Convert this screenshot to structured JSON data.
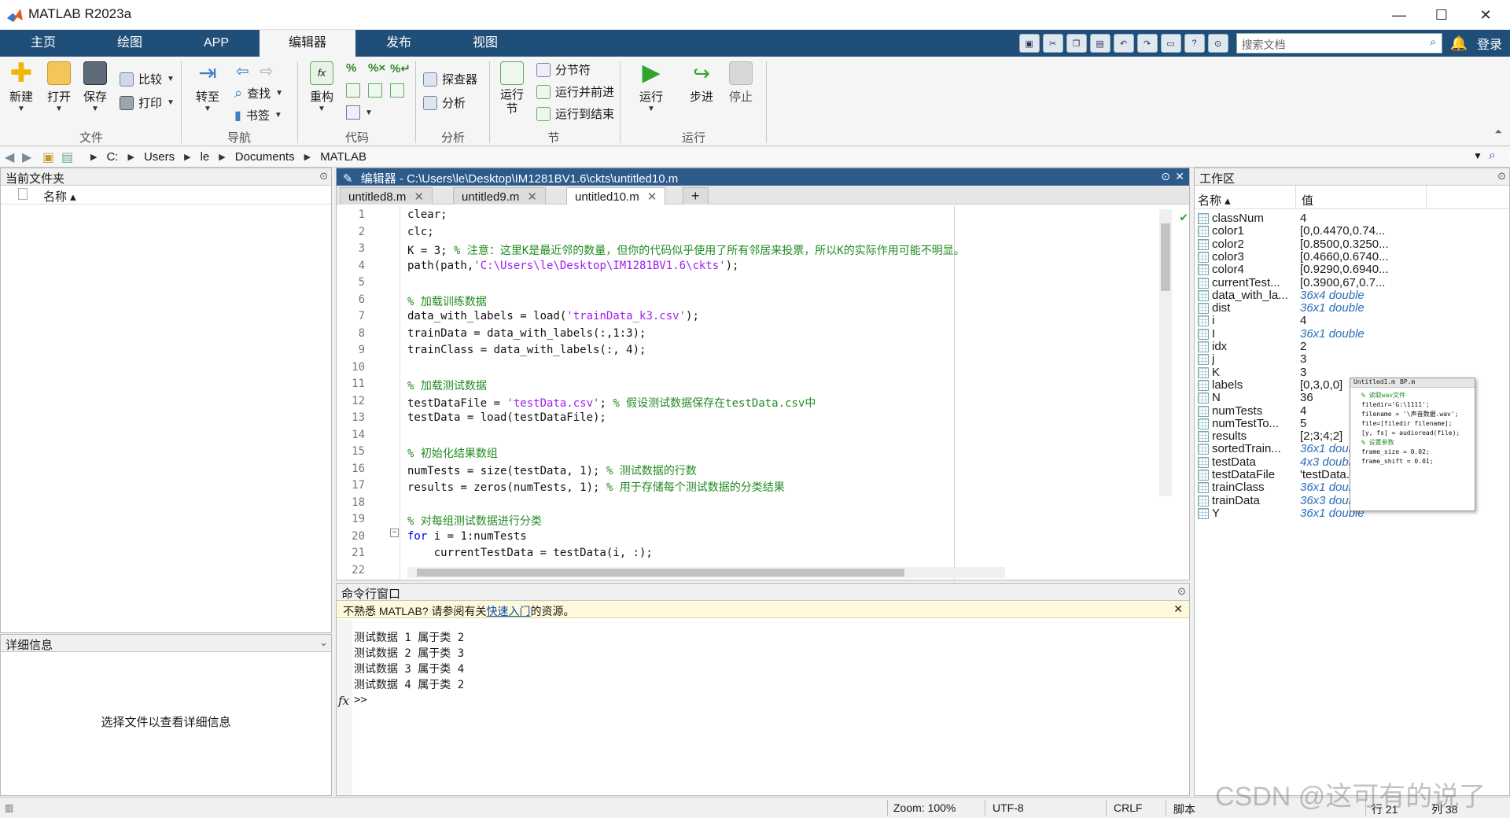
{
  "app": {
    "title": "MATLAB R2023a"
  },
  "window_controls": {
    "minimize": "—",
    "maximize": "☐",
    "close": "✕"
  },
  "ribbon_tabs": [
    "主页",
    "绘图",
    "APP",
    "编辑器",
    "发布",
    "视图"
  ],
  "quickbar": {
    "search_placeholder": "搜索文档",
    "login": "登录"
  },
  "ribbon": {
    "file": {
      "new": "新建",
      "open": "打开",
      "save": "保存",
      "compare": "比较",
      "print": "打印",
      "group": "文件"
    },
    "nav": {
      "goto": "转至",
      "find": "查找",
      "bookmark": "书签",
      "group": "导航"
    },
    "code": {
      "refactor": "重构",
      "group": "代码"
    },
    "analyze": {
      "explorer": "探查器",
      "analyze": "分析",
      "group": "分析"
    },
    "section": {
      "run_section": "运行\n节",
      "section_break": "分节符",
      "run_advance": "运行并前进",
      "run_to_end": "运行到结束",
      "group": "节"
    },
    "run": {
      "run": "运行",
      "step": "步进",
      "stop": "停止",
      "group": "运行"
    }
  },
  "address": {
    "path": [
      "C:",
      "Users",
      "le",
      "Documents",
      "MATLAB"
    ]
  },
  "current_folder": {
    "title": "当前文件夹",
    "col_name": "名称 ▴"
  },
  "details": {
    "title": "详细信息",
    "message": "选择文件以查看详细信息"
  },
  "editor": {
    "title": "编辑器 - C:\\Users\\le\\Desktop\\IM1281BV1.6\\ckts\\untitled10.m",
    "tabs": [
      "untitled8.m",
      "untitled9.m",
      "untitled10.m"
    ],
    "lines": [
      {
        "n": "1",
        "t": "clear;"
      },
      {
        "n": "2",
        "t": "clc;"
      },
      {
        "n": "3",
        "t": "K = 3; ",
        "c": "% 注意：这里K是最近邻的数量，但你的代码似乎使用了所有邻居来投票，所以K的实际作用可能不明显。"
      },
      {
        "n": "4",
        "t": "path(path,",
        "s": "'C:\\Users\\le\\Desktop\\IM1281BV1.6\\ckts'",
        "t2": ");"
      },
      {
        "n": "5",
        "t": ""
      },
      {
        "n": "6",
        "c": "% 加载训练数据"
      },
      {
        "n": "7",
        "t": "data_with_labels = load(",
        "s": "'trainData_k3.csv'",
        "t2": ");"
      },
      {
        "n": "8",
        "t": "trainData = data_with_labels(:,1:3);"
      },
      {
        "n": "9",
        "t": "trainClass = data_with_labels(:, 4);"
      },
      {
        "n": "10",
        "t": ""
      },
      {
        "n": "11",
        "c": "% 加载测试数据"
      },
      {
        "n": "12",
        "t": "testDataFile = ",
        "s": "'testData.csv'",
        "t2": "; ",
        "c2": "% 假设测试数据保存在testData.csv中"
      },
      {
        "n": "13",
        "t": "testData = load(testDataFile);"
      },
      {
        "n": "14",
        "t": ""
      },
      {
        "n": "15",
        "c": "% 初始化结果数组"
      },
      {
        "n": "16",
        "t": "numTests = size(testData, 1); ",
        "c": "% 测试数据的行数"
      },
      {
        "n": "17",
        "t": "results = zeros(numTests, 1); ",
        "c": "% 用于存储每个测试数据的分类结果"
      },
      {
        "n": "18",
        "t": ""
      },
      {
        "n": "19",
        "c": "% 对每组测试数据进行分类"
      },
      {
        "n": "20",
        "k": "for",
        "t": " i = 1:numTests"
      },
      {
        "n": "21",
        "t": "    currentTestData = testData(i, :);"
      },
      {
        "n": "22",
        "t": ""
      }
    ]
  },
  "command": {
    "title": "命令行窗口",
    "info_prefix": "不熟悉 MATLAB? 请参阅有关",
    "info_link": "快速入门",
    "info_suffix": "的资源。",
    "output": [
      "测试数据 1 属于类 2",
      "测试数据 2 属于类 3",
      "测试数据 3 属于类 4",
      "测试数据 4 属于类 2"
    ],
    "prompt": ">>",
    "fx": "fx"
  },
  "workspace": {
    "title": "工作区",
    "col_name": "名称 ▴",
    "col_value": "值",
    "vars": [
      {
        "name": "classNum",
        "value": "4",
        "italic": false
      },
      {
        "name": "color1",
        "value": "[0,0.4470,0.74...",
        "italic": false
      },
      {
        "name": "color2",
        "value": "[0.8500,0.3250...",
        "italic": false
      },
      {
        "name": "color3",
        "value": "[0.4660,0.6740...",
        "italic": false
      },
      {
        "name": "color4",
        "value": "[0.9290,0.6940...",
        "italic": false
      },
      {
        "name": "currentTest...",
        "value": "[0.3900,67,0.7...",
        "italic": false
      },
      {
        "name": "data_with_la...",
        "value": "36x4 double",
        "italic": true
      },
      {
        "name": "dist",
        "value": "36x1 double",
        "italic": true
      },
      {
        "name": "i",
        "value": "4",
        "italic": false
      },
      {
        "name": "I",
        "value": "36x1 double",
        "italic": true
      },
      {
        "name": "idx",
        "value": "2",
        "italic": false
      },
      {
        "name": "j",
        "value": "3",
        "italic": false
      },
      {
        "name": "K",
        "value": "3",
        "italic": false
      },
      {
        "name": "labels",
        "value": "[0,3,0,0]",
        "italic": false
      },
      {
        "name": "N",
        "value": "36",
        "italic": false
      },
      {
        "name": "numTests",
        "value": "4",
        "italic": false
      },
      {
        "name": "numTestTo...",
        "value": "5",
        "italic": false
      },
      {
        "name": "results",
        "value": "[2;3;4;2]",
        "italic": false
      },
      {
        "name": "sortedTrain...",
        "value": "36x1 double",
        "italic": true
      },
      {
        "name": "testData",
        "value": "4x3 double",
        "italic": true
      },
      {
        "name": "testDataFile",
        "value": "'testData.csv'",
        "italic": false
      },
      {
        "name": "trainClass",
        "value": "36x1 double",
        "italic": true
      },
      {
        "name": "trainData",
        "value": "36x3 double",
        "italic": true
      },
      {
        "name": "Y",
        "value": "36x1 double",
        "italic": true
      }
    ]
  },
  "statusbar": {
    "zoom": "Zoom: 100%",
    "encoding": "UTF-8",
    "eol": "CRLF",
    "type": "脚本",
    "line": "行 21",
    "col": "列 38"
  },
  "thumbnail": {
    "tabs": [
      "Untitled1.m",
      "BP.m"
    ],
    "lines": [
      "% 读取wav文件",
      "filedir='G:\\1111';",
      "filename = '\\声音数据.wav';",
      "file=[filedir filename];",
      "[y, fs] = audioread(file);",
      "% 设置参数",
      "frame_size = 0.02;",
      "frame_shift = 0.01;"
    ]
  },
  "watermark": "CSDN @这可有的说了",
  "colors": {
    "tabbar": "#1f4e79",
    "editor_head": "#2b5a8b",
    "comment": "#228b22",
    "string": "#a020f0",
    "keyword": "#0000ff"
  }
}
